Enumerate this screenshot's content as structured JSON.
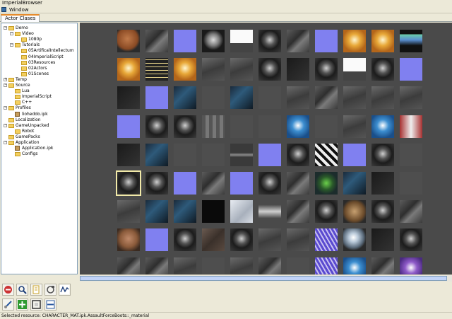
{
  "window": {
    "title": "ImperialBrowser"
  },
  "menu": {
    "items": [
      {
        "label": "Window"
      }
    ]
  },
  "tabs": [
    {
      "label": "Actor Clases",
      "active": true
    }
  ],
  "tree": {
    "nodes": [
      {
        "label": "Demo",
        "level": 0,
        "expander": "-",
        "type": "folder"
      },
      {
        "label": "Video",
        "level": 1,
        "expander": "-",
        "type": "folder"
      },
      {
        "label": "1080p",
        "level": 2,
        "expander": "",
        "type": "folder"
      },
      {
        "label": "Tutorials",
        "level": 1,
        "expander": "-",
        "type": "folder"
      },
      {
        "label": "05ArtificalIntellectum",
        "level": 2,
        "expander": "",
        "type": "folder"
      },
      {
        "label": "04ImperialScript",
        "level": 2,
        "expander": "",
        "type": "folder"
      },
      {
        "label": "03Resources",
        "level": 2,
        "expander": "",
        "type": "folder"
      },
      {
        "label": "02Actors",
        "level": 2,
        "expander": "",
        "type": "folder"
      },
      {
        "label": "01Scenes",
        "level": 2,
        "expander": "",
        "type": "folder"
      },
      {
        "label": "Temp",
        "level": 0,
        "expander": "+",
        "type": "folder"
      },
      {
        "label": "Source",
        "level": 0,
        "expander": "-",
        "type": "folder"
      },
      {
        "label": "Lua",
        "level": 1,
        "expander": "",
        "type": "folder"
      },
      {
        "label": "ImperialScript",
        "level": 1,
        "expander": "",
        "type": "folder"
      },
      {
        "label": "C++",
        "level": 1,
        "expander": "",
        "type": "folder"
      },
      {
        "label": "Profiles",
        "level": 0,
        "expander": "-",
        "type": "folder"
      },
      {
        "label": "lioheddo.ipk",
        "level": 1,
        "expander": "",
        "type": "file"
      },
      {
        "label": "Localization",
        "level": 0,
        "expander": "",
        "type": "folder"
      },
      {
        "label": "GameUnpacked",
        "level": 0,
        "expander": "-",
        "type": "folder"
      },
      {
        "label": "Robot",
        "level": 1,
        "expander": "",
        "type": "folder"
      },
      {
        "label": "GamePacks",
        "level": 0,
        "expander": "",
        "type": "folder"
      },
      {
        "label": "Application",
        "level": 0,
        "expander": "-",
        "type": "folder"
      },
      {
        "label": "Application.ipk",
        "level": 1,
        "expander": "",
        "type": "file"
      },
      {
        "label": "Configs",
        "level": 1,
        "expander": "",
        "type": "folder"
      }
    ]
  },
  "thumbnails": {
    "selected_index": 55,
    "items": [
      "mars",
      "robot",
      "normal",
      "helmet",
      "white",
      "face",
      "robot",
      "normal",
      "emblem-gold",
      "emblem-gold",
      "bottles",
      "emblem-gold",
      "font",
      "emblem-gold",
      "metal",
      "metal",
      "face",
      "dark",
      "face",
      "white",
      "face",
      "normal",
      "dark",
      "normal",
      "scifi",
      "grey",
      "scifi",
      "grey",
      "metal",
      "robot",
      "metal",
      "metal",
      "metal",
      "normal",
      "face",
      "face",
      "floor",
      "grey",
      "grey",
      "emblem-blue",
      "grey",
      "metal",
      "emblem-blue",
      "red",
      "dark",
      "scifi",
      "grey",
      "grey",
      "ship",
      "normal",
      "face",
      "pattern",
      "normal",
      "face",
      "grey",
      "face",
      "face",
      "normal",
      "robot",
      "normal",
      "face",
      "robot",
      "green",
      "scifi",
      "dark",
      "grey",
      "metal",
      "scifi",
      "scifi",
      "black",
      "silver",
      "cone",
      "robot",
      "face",
      "bronze",
      "face",
      "robot",
      "skin",
      "normal",
      "face",
      "cloth",
      "face",
      "metal",
      "metal",
      "purple",
      "sphere",
      "dark",
      "face",
      "robot",
      "robot",
      "metal",
      "grey",
      "metal",
      "robot",
      "grey",
      "purple",
      "emblem-blue",
      "robot",
      "emblem-purple"
    ]
  },
  "toolbar_top": [
    {
      "icon": "stop-icon",
      "color": "#cc3333"
    },
    {
      "icon": "zoom-icon",
      "color": "#1e3f7a"
    },
    {
      "icon": "document-icon",
      "color": "#c9a227"
    },
    {
      "icon": "refresh-icon",
      "color": "#555555"
    },
    {
      "icon": "graph-icon",
      "color": "#1e3f7a"
    }
  ],
  "toolbar_bottom": [
    {
      "icon": "brush-icon",
      "color": "#2c5aa0"
    },
    {
      "icon": "add-icon",
      "color": "#2e9a2e"
    },
    {
      "icon": "frame-icon",
      "color": "#333333"
    },
    {
      "icon": "panel-icon",
      "color": "#2c5aa0"
    }
  ],
  "status": {
    "text": "Selected resource: CHARACTER_MAT.ipk.AssaultForceBoots::_material"
  },
  "colors": {
    "accent_tab": "#e68b2c",
    "grid_bg": "#4a4a4a",
    "tree_border": "#7f9db9"
  }
}
